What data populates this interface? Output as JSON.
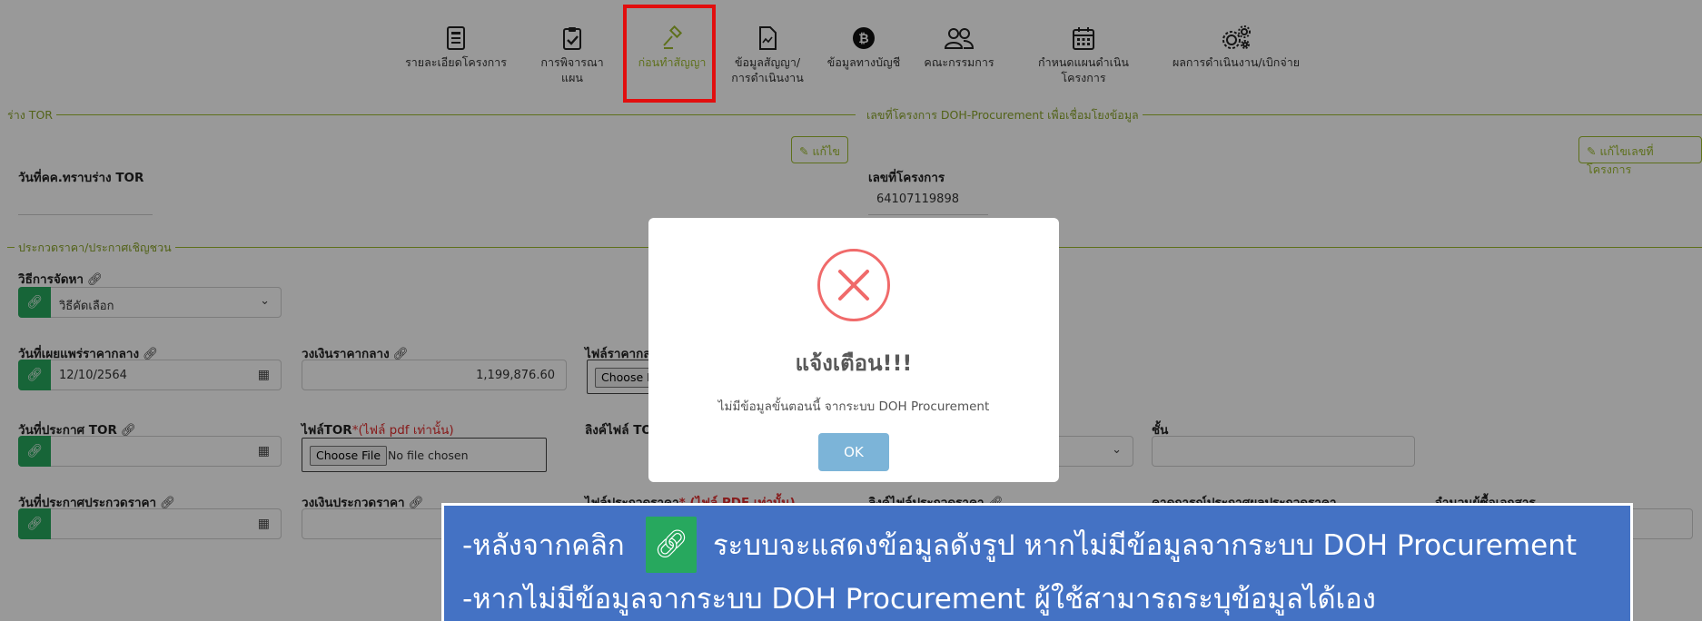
{
  "nav": {
    "items": [
      {
        "label": "รายละเอียดโครงการ",
        "icon": "document-icon"
      },
      {
        "label": "การพิจารณาแผน",
        "icon": "clipboard-check-icon"
      },
      {
        "label": "ก่อนทำสัญญา",
        "icon": "gavel-icon",
        "active": true
      },
      {
        "label": "ข้อมูลสัญญา/",
        "label2": "การดำเนินงาน",
        "icon": "contract-file-icon"
      },
      {
        "label": "ข้อมูลทางบัญชี",
        "icon": "bitcoin-icon"
      },
      {
        "label": "คณะกรรมการ",
        "icon": "users-icon"
      },
      {
        "label": "กำหนดแผนดำเนินโครงการ",
        "icon": "calendar-icon"
      },
      {
        "label": "ผลการดำเนินงาน/เบิกจ่าย",
        "icon": "gears-icon"
      }
    ]
  },
  "sections": {
    "tor": "ร่าง TOR",
    "doh": "เลขที่โครงการ DOH-Procurement เพื่อเชื่อมโยงข้อมูล",
    "announce": "ประกวดราคา/ประกาศเชิญชวน"
  },
  "tor": {
    "ack_date_label": "วันที่คค.ทราบร่าง TOR",
    "edit_label": "แก้ไข"
  },
  "doh": {
    "project_no_label": "เลขที่โครงการ",
    "project_no": "64107119898",
    "edit_label": "แก้ไขเลขที่โครงการ"
  },
  "form": {
    "method_label": "วิธีการจัดหา",
    "method_value": "วิธีคัดเลือก",
    "median_date_label": "วันที่เผยแพร่ราคากลาง",
    "median_date_value": "12/10/2564",
    "median_amount_label": "วงเงินราคากลาง",
    "median_amount_value": "1,199,876.60",
    "median_file_label": "ไฟล์ราคากล",
    "median_file_btn": "Choose F",
    "tor_date_label": "วันที่ประกาศ TOR",
    "tor_file_label": "ไฟล์TOR",
    "tor_file_hint": "*(ไฟล์ pdf เท่านั้น)",
    "tor_file_btn": "Choose File",
    "tor_file_status": "No file chosen",
    "tor_link_label": "ลิงค์ไฟล์ TO",
    "class_label": "ชั้น",
    "bid_date_label": "วันที่ประกาศประกวดราคา",
    "bid_amount_label": "วงเงินประกวดราคา",
    "bid_file_label": "ไฟล์ประกวดราคา",
    "bid_file_hint": "* (ไฟล์ PDF เท่านั้น)",
    "bid_link_label": "ลิงค์ไฟล์ประกวดราคา",
    "bid_result_label": "คาดการณ์ประกาศผลประกวดราคา",
    "buyers_label": "จำนวนผู้ซื้อเอกสาร"
  },
  "modal": {
    "title": "แจ้งเตือน!!!",
    "message": "ไม่มีข้อมูลขั้นตอนนี้ จากระบบ DOH Procurement",
    "ok": "OK"
  },
  "banner": {
    "line1_prefix": "-หลังจากคลิก",
    "line1_suffix": "ระบบจะแสดงข้อมูลดังรูป หากไม่มีข้อมูลจากระบบ DOH Procurement",
    "line2": "-หากไม่มีข้อมูลจากระบบ DOH Procurement  ผู้ใช้สามารถระบุข้อมูลได้เอง"
  },
  "colors": {
    "accent": "#9dbb2e",
    "green": "#27a85e",
    "highlight": "#e20e0e",
    "banner": "#4472c4",
    "ok": "#7cb4d8",
    "error": "#f06a6a"
  }
}
